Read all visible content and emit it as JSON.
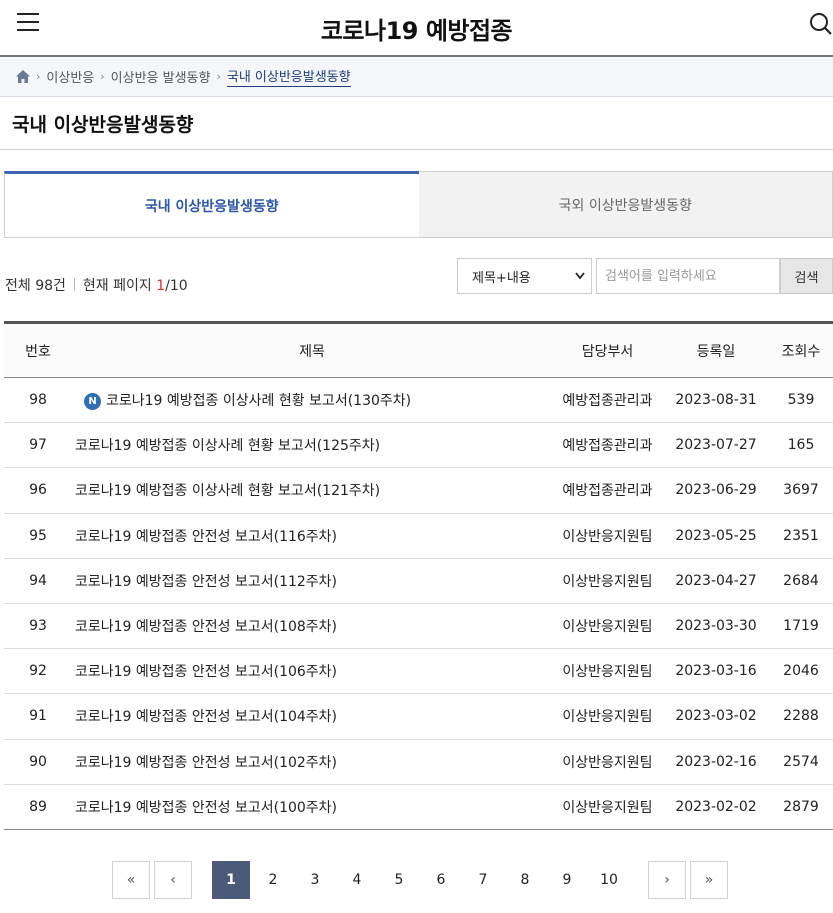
{
  "header": {
    "title": "코로나19 예방접종",
    "menu_icon": "hamburger-menu-icon",
    "search_icon": "search-icon"
  },
  "breadcrumb": {
    "home_icon": "home-icon",
    "items": [
      "이상반응",
      "이상반응 발생동향",
      "국내 이상반응발생동향"
    ]
  },
  "page_title": "국내 이상반응발생동향",
  "tabs": [
    {
      "label": "국내 이상반응발생동향",
      "active": true
    },
    {
      "label": "국외 이상반응발생동향",
      "active": false
    }
  ],
  "summary": {
    "total_label": "전체 98건",
    "page_label": "현재 페이지",
    "current_page": "1",
    "total_pages": "/10"
  },
  "search": {
    "select_value": "제목+내용",
    "placeholder": "검색어를 입력하세요",
    "button_label": "검색"
  },
  "table": {
    "headers": [
      "번호",
      "제목",
      "담당부서",
      "등록일",
      "조회수"
    ],
    "rows": [
      {
        "num": "98",
        "title": "코로나19 예방접종 이상사례 현황 보고서(130주차)",
        "dept": "예방접종관리과",
        "date": "2023-08-31",
        "views": "539",
        "is_new": true,
        "badge": "N"
      },
      {
        "num": "97",
        "title": "코로나19 예방접종 이상사례 현황 보고서(125주차)",
        "dept": "예방접종관리과",
        "date": "2023-07-27",
        "views": "165",
        "is_new": false
      },
      {
        "num": "96",
        "title": "코로나19 예방접종 이상사례 현황 보고서(121주차)",
        "dept": "예방접종관리과",
        "date": "2023-06-29",
        "views": "3697",
        "is_new": false
      },
      {
        "num": "95",
        "title": "코로나19 예방접종 안전성 보고서(116주차)",
        "dept": "이상반응지원팀",
        "date": "2023-05-25",
        "views": "2351",
        "is_new": false
      },
      {
        "num": "94",
        "title": "코로나19 예방접종 안전성 보고서(112주차)",
        "dept": "이상반응지원팀",
        "date": "2023-04-27",
        "views": "2684",
        "is_new": false
      },
      {
        "num": "93",
        "title": "코로나19 예방접종 안전성 보고서(108주차)",
        "dept": "이상반응지원팀",
        "date": "2023-03-30",
        "views": "1719",
        "is_new": false
      },
      {
        "num": "92",
        "title": "코로나19 예방접종 안전성 보고서(106주차)",
        "dept": "이상반응지원팀",
        "date": "2023-03-16",
        "views": "2046",
        "is_new": false
      },
      {
        "num": "91",
        "title": "코로나19 예방접종 안전성 보고서(104주차)",
        "dept": "이상반응지원팀",
        "date": "2023-03-02",
        "views": "2288",
        "is_new": false
      },
      {
        "num": "90",
        "title": "코로나19 예방접종 안전성 보고서(102주차)",
        "dept": "이상반응지원팀",
        "date": "2023-02-16",
        "views": "2574",
        "is_new": false
      },
      {
        "num": "89",
        "title": "코로나19 예방접종 안전성 보고서(100주차)",
        "dept": "이상반응지원팀",
        "date": "2023-02-02",
        "views": "2879",
        "is_new": false
      }
    ]
  },
  "pagination": {
    "first": "«",
    "prev": "‹",
    "pages": [
      "1",
      "2",
      "3",
      "4",
      "5",
      "6",
      "7",
      "8",
      "9",
      "10"
    ],
    "active_page": "1",
    "next": "›",
    "last": "»"
  },
  "colors": {
    "accent": "#3d66b0",
    "active_page_bg": "#4a5a78",
    "current_page_red": "#d6322e",
    "new_badge": "#2e6eb5"
  }
}
